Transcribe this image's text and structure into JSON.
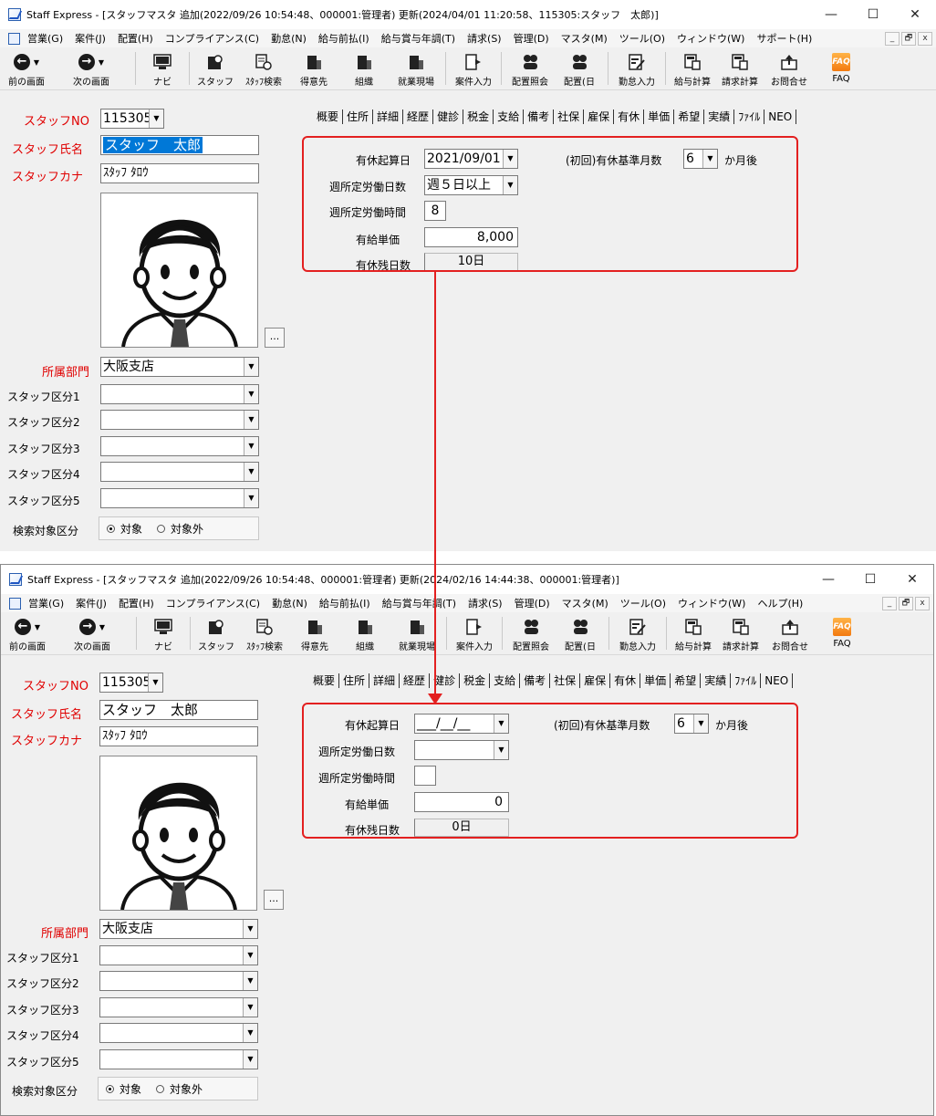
{
  "colors": {
    "highlight": "#e32020",
    "label_red": "#e00000",
    "selection": "#0078d7"
  },
  "window_controls": {
    "minimize": "—",
    "maximize": "☐",
    "close": "✕"
  },
  "menu": [
    "営業(G)",
    "案件(J)",
    "配置(H)",
    "コンプライアンス(C)",
    "勤怠(N)",
    "給与前払(I)",
    "給与賞与年調(T)",
    "請求(S)",
    "管理(D)",
    "マスタ(M)",
    "ツール(O)",
    "ウィンドウ(W)"
  ],
  "mdi": {
    "min": "_",
    "restore": "🗗",
    "close": "x"
  },
  "toolbar": {
    "back": "前の画面",
    "forward": "次の画面",
    "navi": "ナビ",
    "staff": "スタッフ",
    "staff_search": "ｽﾀｯﾌ検索",
    "client": "得意先",
    "org": "組織",
    "site": "就業現場",
    "case_entry": "案件入力",
    "placement_inquiry": "配置照会",
    "placement_day": "配置(日",
    "attendance_entry": "勤怠入力",
    "payroll_calc": "給与計算",
    "billing_calc": "請求計算",
    "contact": "お問合せ",
    "faq": "FAQ"
  },
  "tabs": [
    "概要",
    "住所",
    "詳細",
    "経歴",
    "健診",
    "税金",
    "支給",
    "備考",
    "社保",
    "雇保",
    "有休",
    "単価",
    "希望",
    "実績",
    "ﾌｧｲﾙ",
    "NEO"
  ],
  "labels": {
    "staff_no": "スタッフNO",
    "staff_name": "スタッフ氏名",
    "staff_kana": "スタッフカナ",
    "dept": "所属部門",
    "kubun1": "スタッフ区分1",
    "kubun2": "スタッフ区分2",
    "kubun3": "スタッフ区分3",
    "kubun4": "スタッフ区分4",
    "kubun5": "スタッフ区分5",
    "search_target": "検索対象区分",
    "target": "対象",
    "non_target": "対象外",
    "dots": "...",
    "leave_start": "有休起算日",
    "weekly_days": "週所定労働日数",
    "weekly_hours": "週所定労働時間",
    "paid_unit": "有給単価",
    "leave_remaining": "有休残日数",
    "base_months": "(初回)有休基準月数",
    "months_after": "か月後"
  },
  "before": {
    "title": "Staff Express - [スタッフマスタ  追加(2022/09/26 10:54:48、000001:管理者)  更新(2024/04/01 11:20:58、115305:スタッフ　太郎)]",
    "menu_last": "サポート(H)",
    "staff_no": "115305",
    "staff_name": "スタッフ　太郎",
    "staff_kana": "ｽﾀｯﾌ ﾀﾛｳ",
    "dept": "大阪支店",
    "leave_start": "2021/09/01",
    "weekly_days": "週５日以上",
    "weekly_hours": "8",
    "paid_unit": "8,000",
    "leave_remaining": "10日",
    "base_months": "6"
  },
  "after": {
    "title": "Staff Express - [スタッフマスタ  追加(2022/09/26 10:54:48、000001:管理者)  更新(2024/02/16 14:44:38、000001:管理者)]",
    "menu_last": "ヘルプ(H)",
    "staff_no": "115305",
    "staff_name": "スタッフ　太郎",
    "staff_kana": "ｽﾀｯﾌ ﾀﾛｳ",
    "dept": "大阪支店",
    "leave_start": "___/__/__",
    "weekly_days": "",
    "weekly_hours": "",
    "paid_unit": "0",
    "leave_remaining": "0日",
    "base_months": "6"
  }
}
